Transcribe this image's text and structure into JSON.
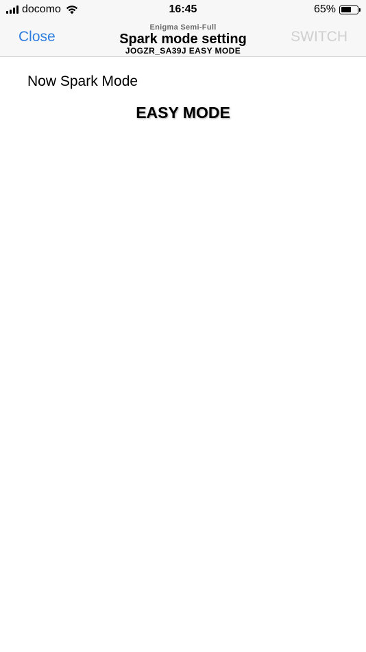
{
  "status_bar": {
    "carrier": "docomo",
    "time": "16:45",
    "battery_percent_text": "65%",
    "battery_level": 0.65,
    "icons": [
      "signal-icon",
      "wifi-icon",
      "battery-icon"
    ]
  },
  "nav": {
    "close_label": "Close",
    "pre_title": "Enigma Semi-Full",
    "title": "Spark mode setting",
    "subtitle": "JOGZR_SA39J EASY MODE",
    "switch_label": "SWITCH"
  },
  "content": {
    "now_label": "Now Spark Mode",
    "mode_value": "EASY MODE"
  },
  "colors": {
    "accent": "#2f7de1",
    "disabled": "#cfcfcf",
    "bar_background": "#f7f7f7"
  }
}
